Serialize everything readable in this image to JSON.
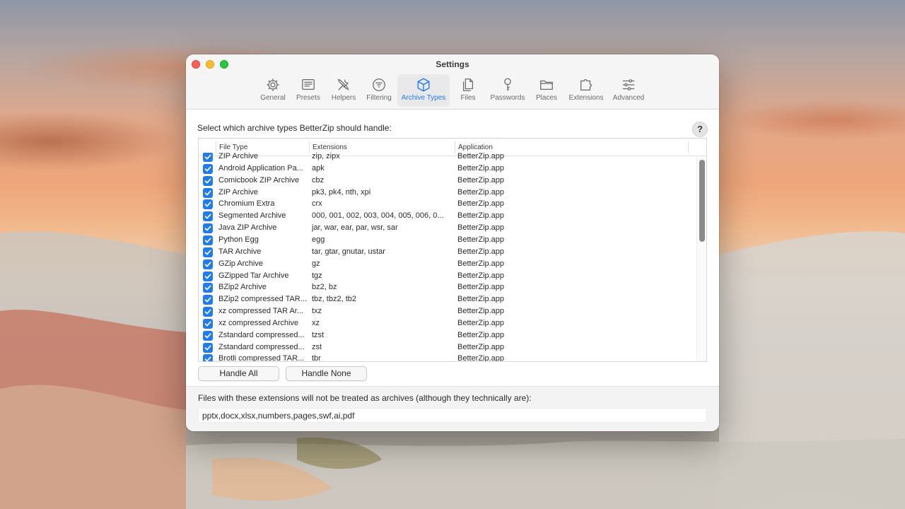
{
  "window": {
    "title": "Settings"
  },
  "toolbar": {
    "items": [
      {
        "label": "General",
        "icon": "gear-icon"
      },
      {
        "label": "Presets",
        "icon": "presets-icon"
      },
      {
        "label": "Helpers",
        "icon": "wrench-screwdriver-icon"
      },
      {
        "label": "Filtering",
        "icon": "filter-icon"
      },
      {
        "label": "Archive Types",
        "icon": "box-icon",
        "active": true
      },
      {
        "label": "Files",
        "icon": "files-icon"
      },
      {
        "label": "Passwords",
        "icon": "key-icon"
      },
      {
        "label": "Places",
        "icon": "folder-icon"
      },
      {
        "label": "Extensions",
        "icon": "puzzle-icon"
      },
      {
        "label": "Advanced",
        "icon": "sliders-icon"
      }
    ]
  },
  "main": {
    "heading": "Select which archive types BetterZip should handle:",
    "help_label": "?",
    "columns": [
      "File Type",
      "Extensions",
      "Application"
    ],
    "rows": [
      {
        "type": "ZIP Archive",
        "ext": "zip, zipx",
        "app": "BetterZip.app",
        "checked": true
      },
      {
        "type": "Android Application Pa...",
        "ext": "apk",
        "app": "BetterZip.app",
        "checked": true
      },
      {
        "type": "Comicbook ZIP Archive",
        "ext": "cbz",
        "app": "BetterZip.app",
        "checked": true
      },
      {
        "type": "ZIP Archive",
        "ext": "pk3, pk4, nth, xpi",
        "app": "BetterZip.app",
        "checked": true
      },
      {
        "type": "Chromium Extra",
        "ext": "crx",
        "app": "BetterZip.app",
        "checked": true
      },
      {
        "type": "Segmented Archive",
        "ext": "000, 001, 002, 003, 004, 005, 006, 0...",
        "app": "BetterZip.app",
        "checked": true
      },
      {
        "type": "Java ZIP Archive",
        "ext": "jar, war, ear, par, wsr, sar",
        "app": "BetterZip.app",
        "checked": true
      },
      {
        "type": "Python Egg",
        "ext": "egg",
        "app": "BetterZip.app",
        "checked": true
      },
      {
        "type": "TAR Archive",
        "ext": "tar, gtar, gnutar, ustar",
        "app": "BetterZip.app",
        "checked": true
      },
      {
        "type": "GZip Archive",
        "ext": "gz",
        "app": "BetterZip.app",
        "checked": true
      },
      {
        "type": "GZipped Tar Archive",
        "ext": "tgz",
        "app": "BetterZip.app",
        "checked": true
      },
      {
        "type": "BZip2 Archive",
        "ext": "bz2, bz",
        "app": "BetterZip.app",
        "checked": true
      },
      {
        "type": "BZip2 compressed TAR...",
        "ext": "tbz, tbz2, tb2",
        "app": "BetterZip.app",
        "checked": true
      },
      {
        "type": "xz compressed TAR Ar...",
        "ext": "txz",
        "app": "BetterZip.app",
        "checked": true
      },
      {
        "type": "xz compressed Archive",
        "ext": "xz",
        "app": "BetterZip.app",
        "checked": true
      },
      {
        "type": "Zstandard compressed...",
        "ext": "tzst",
        "app": "BetterZip.app",
        "checked": true
      },
      {
        "type": "Zstandard compressed...",
        "ext": "zst",
        "app": "BetterZip.app",
        "checked": true
      },
      {
        "type": "Brotli compressed TAR...",
        "ext": "tbr",
        "app": "BetterZip.app",
        "checked": true
      }
    ],
    "handle_all_label": "Handle All",
    "handle_none_label": "Handle None"
  },
  "footer": {
    "label": "Files with these extensions will not be treated as archives (although they technically are):",
    "excluded_value": "pptx,docx,xlsx,numbers,pages,swf,ai,pdf"
  },
  "colors": {
    "accent": "#1f7ce9",
    "window_bg": "#ffffff",
    "toolbar_bg": "#f5f5f5"
  }
}
